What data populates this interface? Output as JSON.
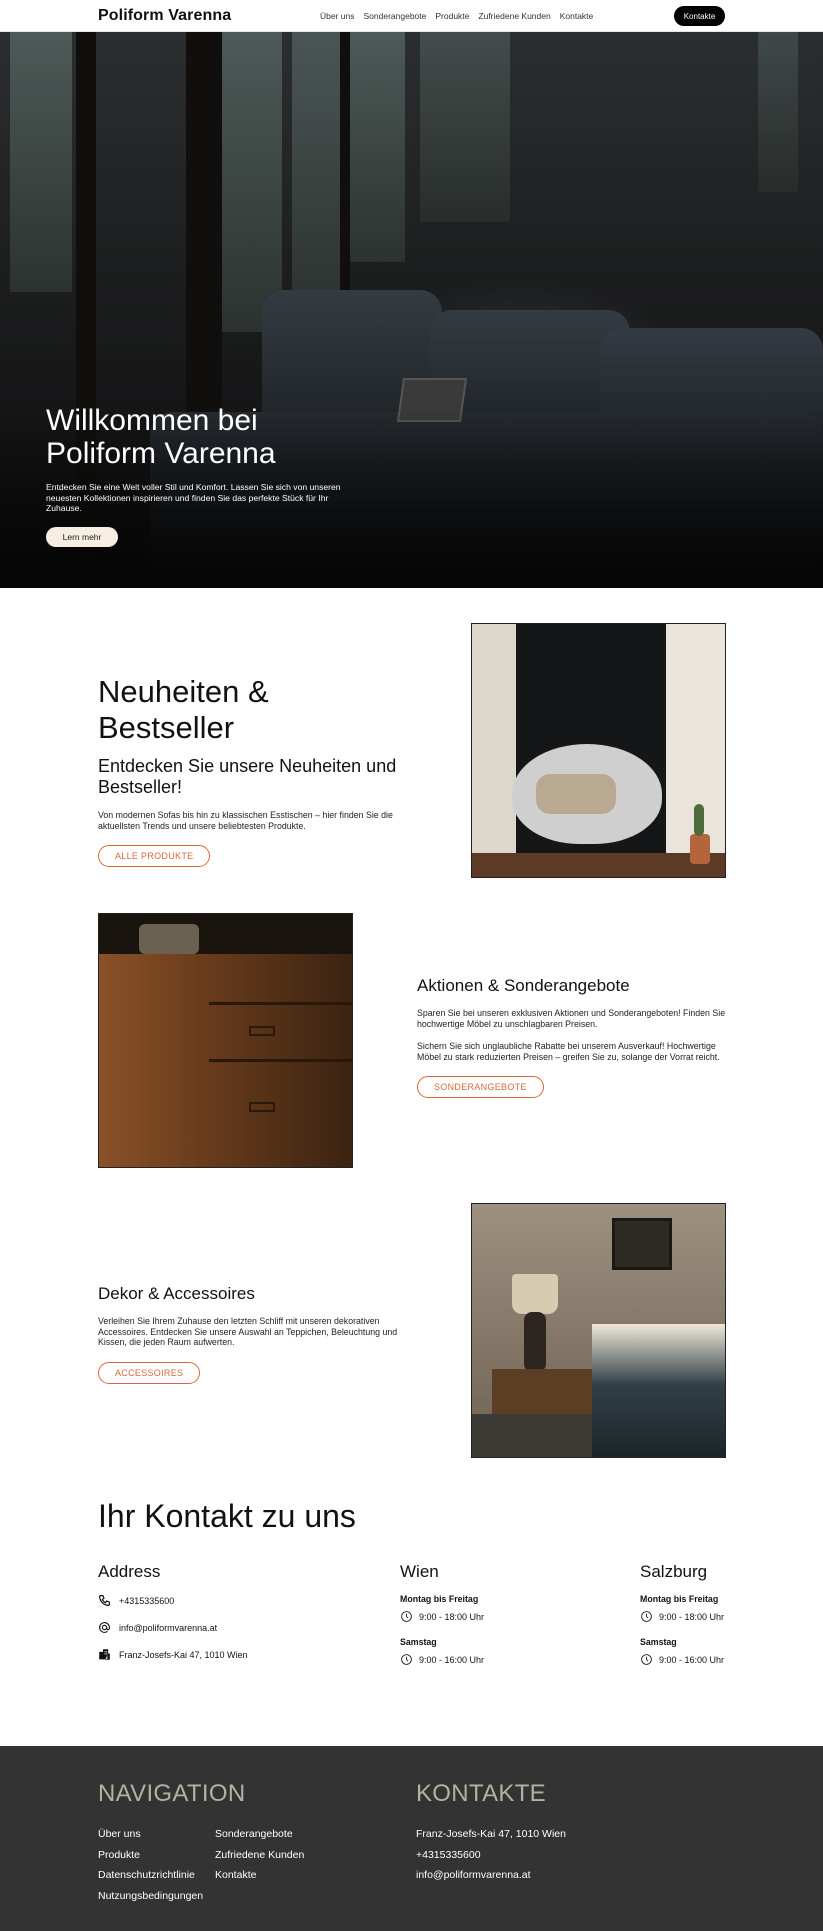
{
  "header": {
    "logo": "Poliform Varenna",
    "nav": [
      "Über uns",
      "Sonderangebote",
      "Produkte",
      "Zufriedene Kunden",
      "Kontakte"
    ],
    "cta": "Kontakte"
  },
  "hero": {
    "title_line1": "Willkommen bei",
    "title_line2": "Poliform Varenna",
    "description": "Entdecken Sie eine Welt voller Stil und Komfort. Lassen Sie sich von unseren neuesten Kollektionen inspirieren und finden Sie das perfekte Stück für Ihr Zuhause.",
    "button": "Lern mehr"
  },
  "features": {
    "new": {
      "title": "Neuheiten & Bestseller",
      "subtitle": "Entdecken Sie unsere Neuheiten und Bestseller!",
      "text": "Von modernen Sofas bis hin zu klassischen Esstischen – hier finden Sie die aktuellsten Trends und unsere beliebtesten Produkte.",
      "button": "ALLE PRODUKTE"
    },
    "sale": {
      "title": "Aktionen & Sonderangebote",
      "text1": "Sparen Sie bei unseren exklusiven Aktionen und Sonderangeboten! Finden Sie hochwertige Möbel zu unschlagbaren Preisen.",
      "text2": "Sichern Sie sich unglaubliche Rabatte bei unserem Ausverkauf! Hochwertige Möbel zu stark reduzierten Preisen – greifen Sie zu, solange der Vorrat reicht.",
      "button": "SONDERANGEBOTE"
    },
    "decor": {
      "title": "Dekor & Accessoires",
      "text": "Verleihen Sie Ihrem Zuhause den letzten Schliff mit unseren dekorativen Accessoires. Entdecken Sie unsere Auswahl an Teppichen, Beleuchtung und Kissen, die jeden Raum aufwerten.",
      "button": "ACCESSOIRES"
    }
  },
  "contact": {
    "title": "Ihr Kontakt zu uns",
    "address": {
      "heading": "Address",
      "phone": "+4315335600",
      "email": "info@poliformvarenna.at",
      "street": "Franz-Josefs-Kai 47, 1010 Wien"
    },
    "wien": {
      "heading": "Wien",
      "weekday_label": "Montag bis Freitag",
      "weekday_hours": "9:00 - 18:00 Uhr",
      "saturday_label": "Samstag",
      "saturday_hours": "9:00 - 16:00 Uhr"
    },
    "salzburg": {
      "heading": "Salzburg",
      "weekday_label": "Montag bis Freitag",
      "weekday_hours": "9:00 - 18:00 Uhr",
      "saturday_label": "Samstag",
      "saturday_hours": "9:00 - 16:00 Uhr"
    }
  },
  "footer": {
    "nav_heading": "NAVIGATION",
    "nav_links": [
      "Über uns",
      "Sonderangebote",
      "Produkte",
      "Zufriedene Kunden",
      "Datenschutzrichtlinie",
      "Kontakte",
      "Nutzungsbedingungen"
    ],
    "contact_heading": "KONTAKTE",
    "contact_lines": [
      "Franz-Josefs-Kai 47, 1010 Wien",
      "+4315335600",
      "info@poliformvarenna.at"
    ]
  },
  "colors": {
    "accent": "#d9683a",
    "footer_bg": "#333333",
    "footer_heading": "#b5b0a2",
    "hero_button_bg": "#f6efe1"
  }
}
